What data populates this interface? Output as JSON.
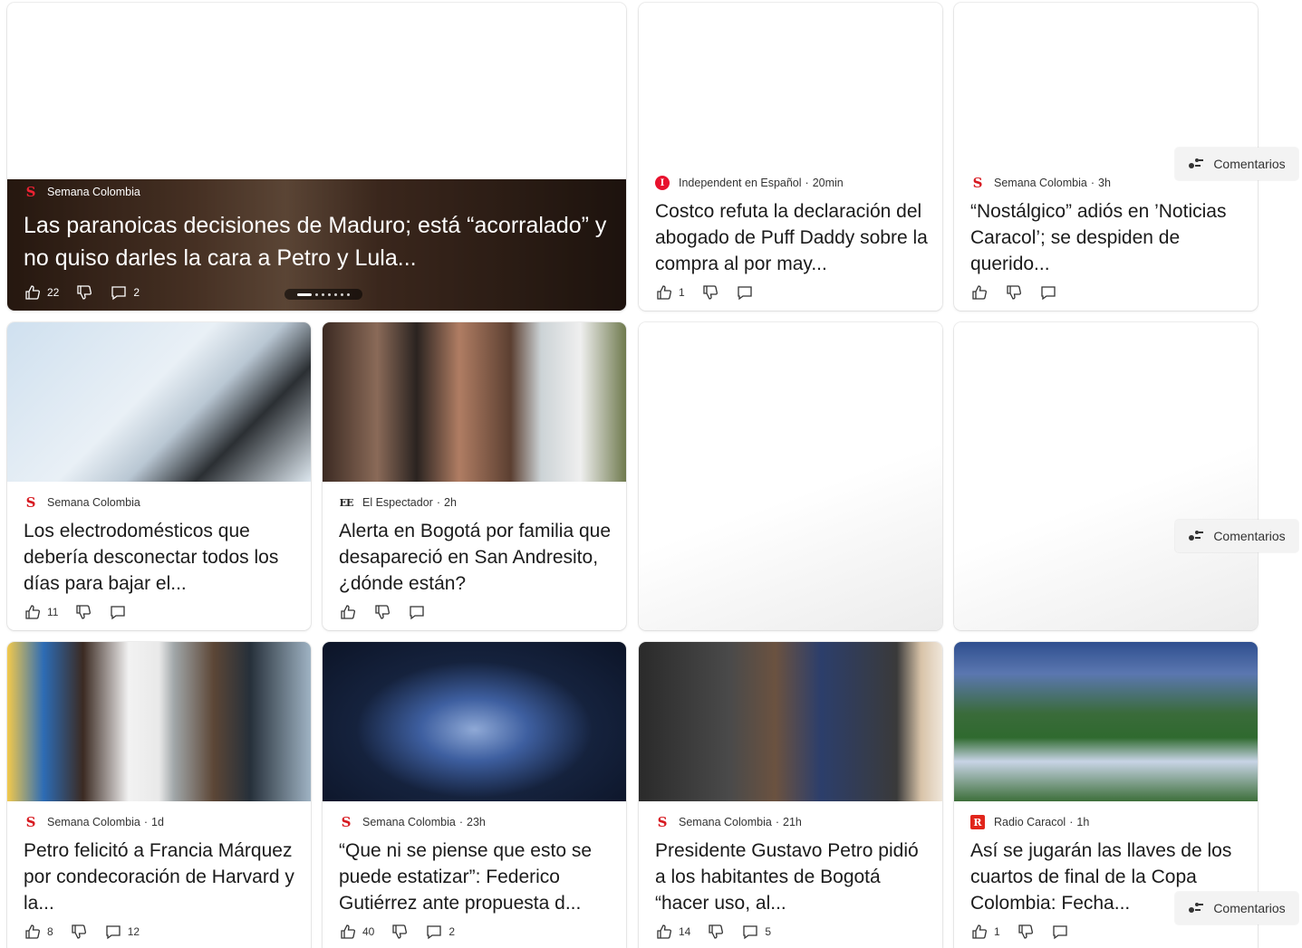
{
  "hero": {
    "source": "Semana Colombia",
    "title": "Las paranoicas decisiones de Maduro; está “acorralado” y no quiso darles la cara a Petro y Lula...",
    "likes": "22",
    "comments": "2"
  },
  "cards": [
    {
      "source": "Independent en Español",
      "time": "20min",
      "title": "Costco refuta la declaración del abogado de Puff Daddy sobre la compra al por may...",
      "likes": "1",
      "comments": ""
    },
    {
      "source": "Semana Colombia",
      "time": "3h",
      "title": "“Nostálgico” adiós en ’Noticias Caracol’; se despiden de querido...",
      "likes": "",
      "comments": ""
    },
    {
      "source": "Semana Colombia",
      "time": "",
      "title": "Los electrodomésticos que debería desconectar todos los días para bajar el...",
      "likes": "11",
      "comments": ""
    },
    {
      "source": "El Espectador",
      "time": "2h",
      "title": "Alerta en Bogotá por familia que desapareció en San Andresito, ¿dónde están?",
      "likes": "",
      "comments": ""
    },
    {
      "source": "Semana Colombia",
      "time": "1d",
      "title": "Petro felicitó a Francia Márquez por condecoración de Harvard y la...",
      "likes": "8",
      "comments": "12"
    },
    {
      "source": "Semana Colombia",
      "time": "23h",
      "title": "“Que ni se piense que esto se puede estatizar”: Federico Gutiérrez ante propuesta d...",
      "likes": "40",
      "comments": "2"
    },
    {
      "source": "Semana Colombia",
      "time": "21h",
      "title": "Presidente Gustavo Petro pidió a los habitantes de Bogotá “hacer uso, al...",
      "likes": "14",
      "comments": "5"
    },
    {
      "source": "Radio Caracol",
      "time": "1h",
      "title": "Así se jugarán las llaves de los cuartos de final de la Copa Colombia: Fecha...",
      "likes": "1",
      "comments": ""
    }
  ],
  "comment_pill": "Comentarios",
  "icons": {
    "like": "thumbs-up-icon",
    "dislike": "thumbs-down-icon",
    "comment": "comment-icon"
  },
  "colors": {
    "semana_red": "#d71920",
    "radio_red": "#e1251b"
  }
}
